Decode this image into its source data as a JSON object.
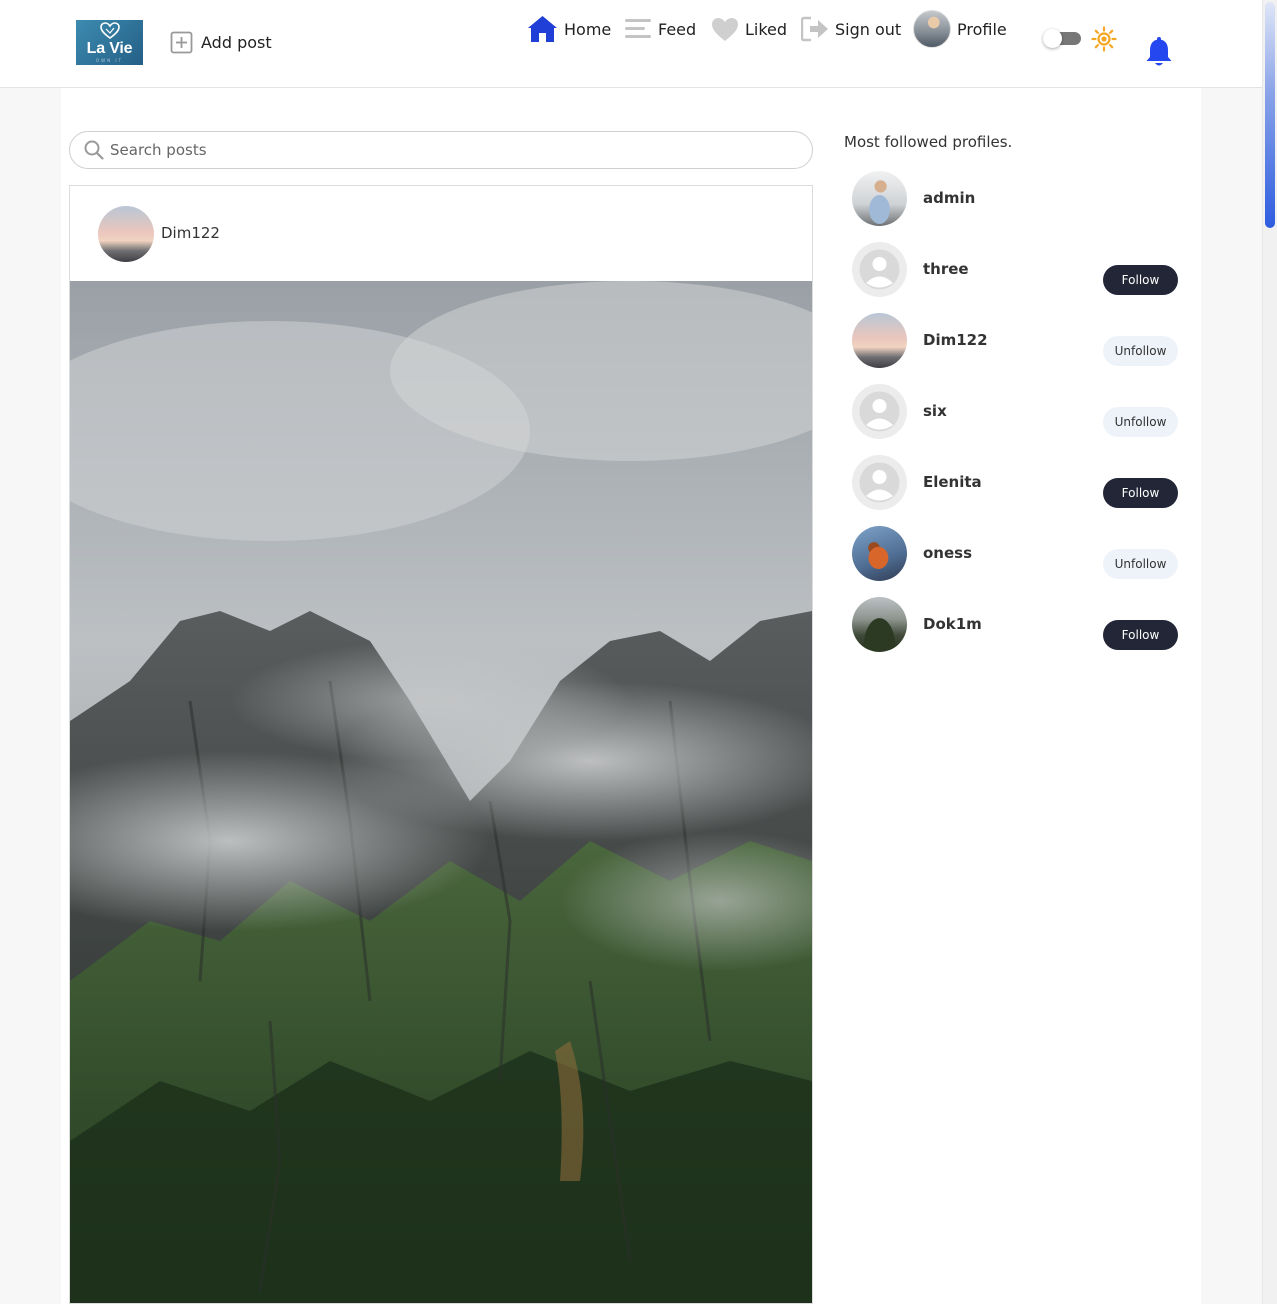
{
  "header": {
    "logo": {
      "text": "La Vie",
      "sub": "OWN IT"
    },
    "add_post_label": "Add post",
    "nav": {
      "home": "Home",
      "feed": "Feed",
      "liked": "Liked",
      "signout": "Sign out",
      "profile": "Profile"
    },
    "theme_toggle": {
      "state": "light"
    },
    "icons": [
      "home-icon",
      "feed-icon",
      "heart-icon",
      "sign-out-icon",
      "sun-icon",
      "bell-icon",
      "plus-square-icon"
    ]
  },
  "search": {
    "placeholder": "Search posts",
    "value": ""
  },
  "post": {
    "username": "Dim122",
    "image": "misty-mountain-photo"
  },
  "sidebar": {
    "title": "Most followed profiles.",
    "profiles": [
      {
        "name": "admin",
        "button": ""
      },
      {
        "name": "three",
        "button": "Follow"
      },
      {
        "name": "Dim122",
        "button": "Unfollow"
      },
      {
        "name": "six",
        "button": "Unfollow"
      },
      {
        "name": "Elenita",
        "button": "Follow"
      },
      {
        "name": "oness",
        "button": "Unfollow"
      },
      {
        "name": "Dok1m",
        "button": "Follow"
      }
    ]
  },
  "colors": {
    "accent_blue": "#1f3fd6",
    "bell_blue": "#2447f0",
    "sun_orange": "#f5a623",
    "follow_bg": "#222636",
    "unfollow_bg": "#eef3fa"
  }
}
